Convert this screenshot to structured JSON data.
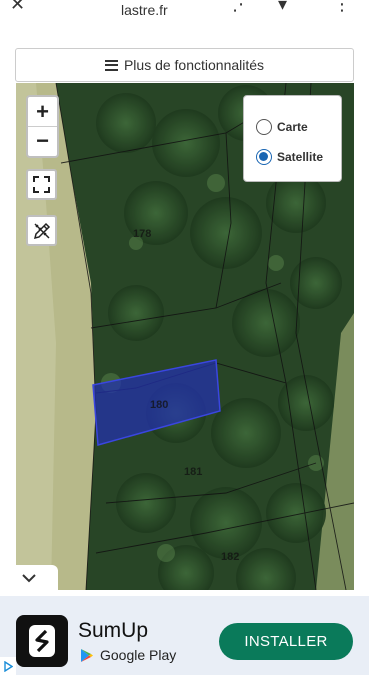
{
  "browser": {
    "url_fragment": "lastre.fr",
    "icons": [
      "close-icon",
      "share-icon",
      "bookmark-icon",
      "more-icon"
    ]
  },
  "features": {
    "label": "Plus de fonctionnalités",
    "icon": "hamburger-icon"
  },
  "map": {
    "zoom_in": "+",
    "zoom_out": "−",
    "fullscreen_icon": "fullscreen-icon",
    "draw_icon": "pencil-ruler-icon",
    "layers": [
      {
        "label": "Carte",
        "selected": false
      },
      {
        "label": "Satellite",
        "selected": true
      }
    ],
    "parcel_labels": [
      "178",
      "180",
      "181",
      "182"
    ],
    "highlight_color": "#2230b0"
  },
  "collapse": {
    "icon": "chevron-down-icon"
  },
  "ad": {
    "app_name": "SumUp",
    "store": "Google Play",
    "install_label": "INSTALLER",
    "accent": "#0a7a5a"
  }
}
